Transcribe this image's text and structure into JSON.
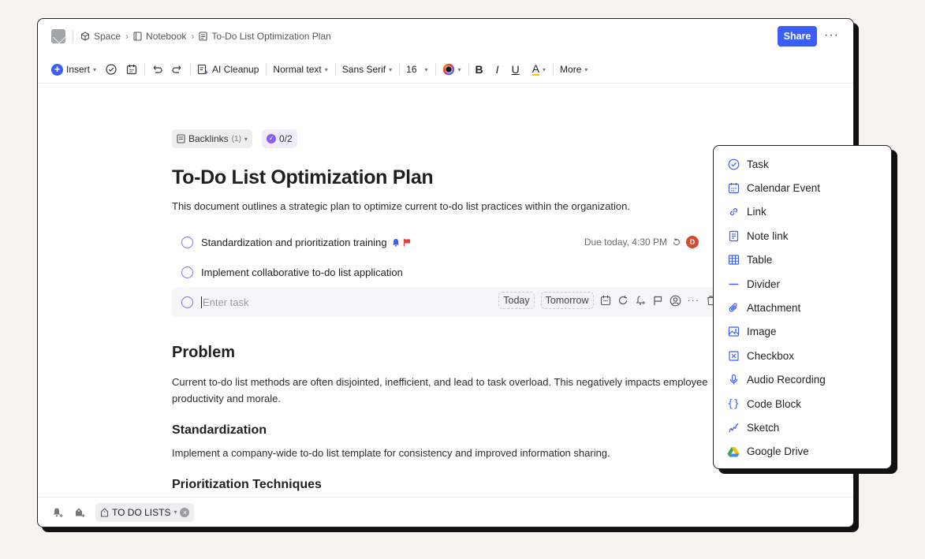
{
  "breadcrumb": {
    "space": "Space",
    "notebook": "Notebook",
    "page": "To-Do List Optimization Plan"
  },
  "header": {
    "share_label": "Share",
    "more_label": "···"
  },
  "toolbar": {
    "insert_label": "Insert",
    "ai_cleanup_label": "AI Cleanup",
    "text_style": "Normal text",
    "font_family": "Sans Serif",
    "font_size": "16",
    "bold": "B",
    "italic": "I",
    "underline": "U",
    "highlight": "A",
    "more_label": "More"
  },
  "doc": {
    "backlinks_label": "Backlinks",
    "backlinks_count": "(1)",
    "progress": "0/2",
    "title": "To-Do List Optimization Plan",
    "lead": "This document outlines a strategic plan to optimize current to-do list practices within the organization.",
    "tasks": [
      {
        "label": "Standardization and prioritization training",
        "due": "Due today, 4:30 PM",
        "assignee": "D"
      },
      {
        "label": "Implement collaborative to-do list application"
      }
    ],
    "task_input_placeholder": "Enter task",
    "chip_today": "Today",
    "chip_tomorrow": "Tomorrow",
    "h_problem": "Problem",
    "p_problem": "Current to-do list methods are often disjointed, inefficient, and lead to task overload. This negatively impacts employee productivity and morale.",
    "h_standardization": "Standardization",
    "p_standardization": "Implement a company-wide to-do list template for consistency and improved information sharing.",
    "h_prioritization": "Prioritization Techniques"
  },
  "bottom": {
    "tag_label": "TO DO LISTS"
  },
  "insert_menu": {
    "items": [
      "Task",
      "Calendar Event",
      "Link",
      "Note link",
      "Table",
      "Divider",
      "Attachment",
      "Image",
      "Checkbox",
      "Audio Recording",
      "Code Block",
      "Sketch",
      "Google Drive"
    ]
  },
  "colors": {
    "accent": "#3b5ef6",
    "task_ring": "#8b6cf0",
    "avatar": "#d8472f",
    "flag": "#e2403b"
  }
}
